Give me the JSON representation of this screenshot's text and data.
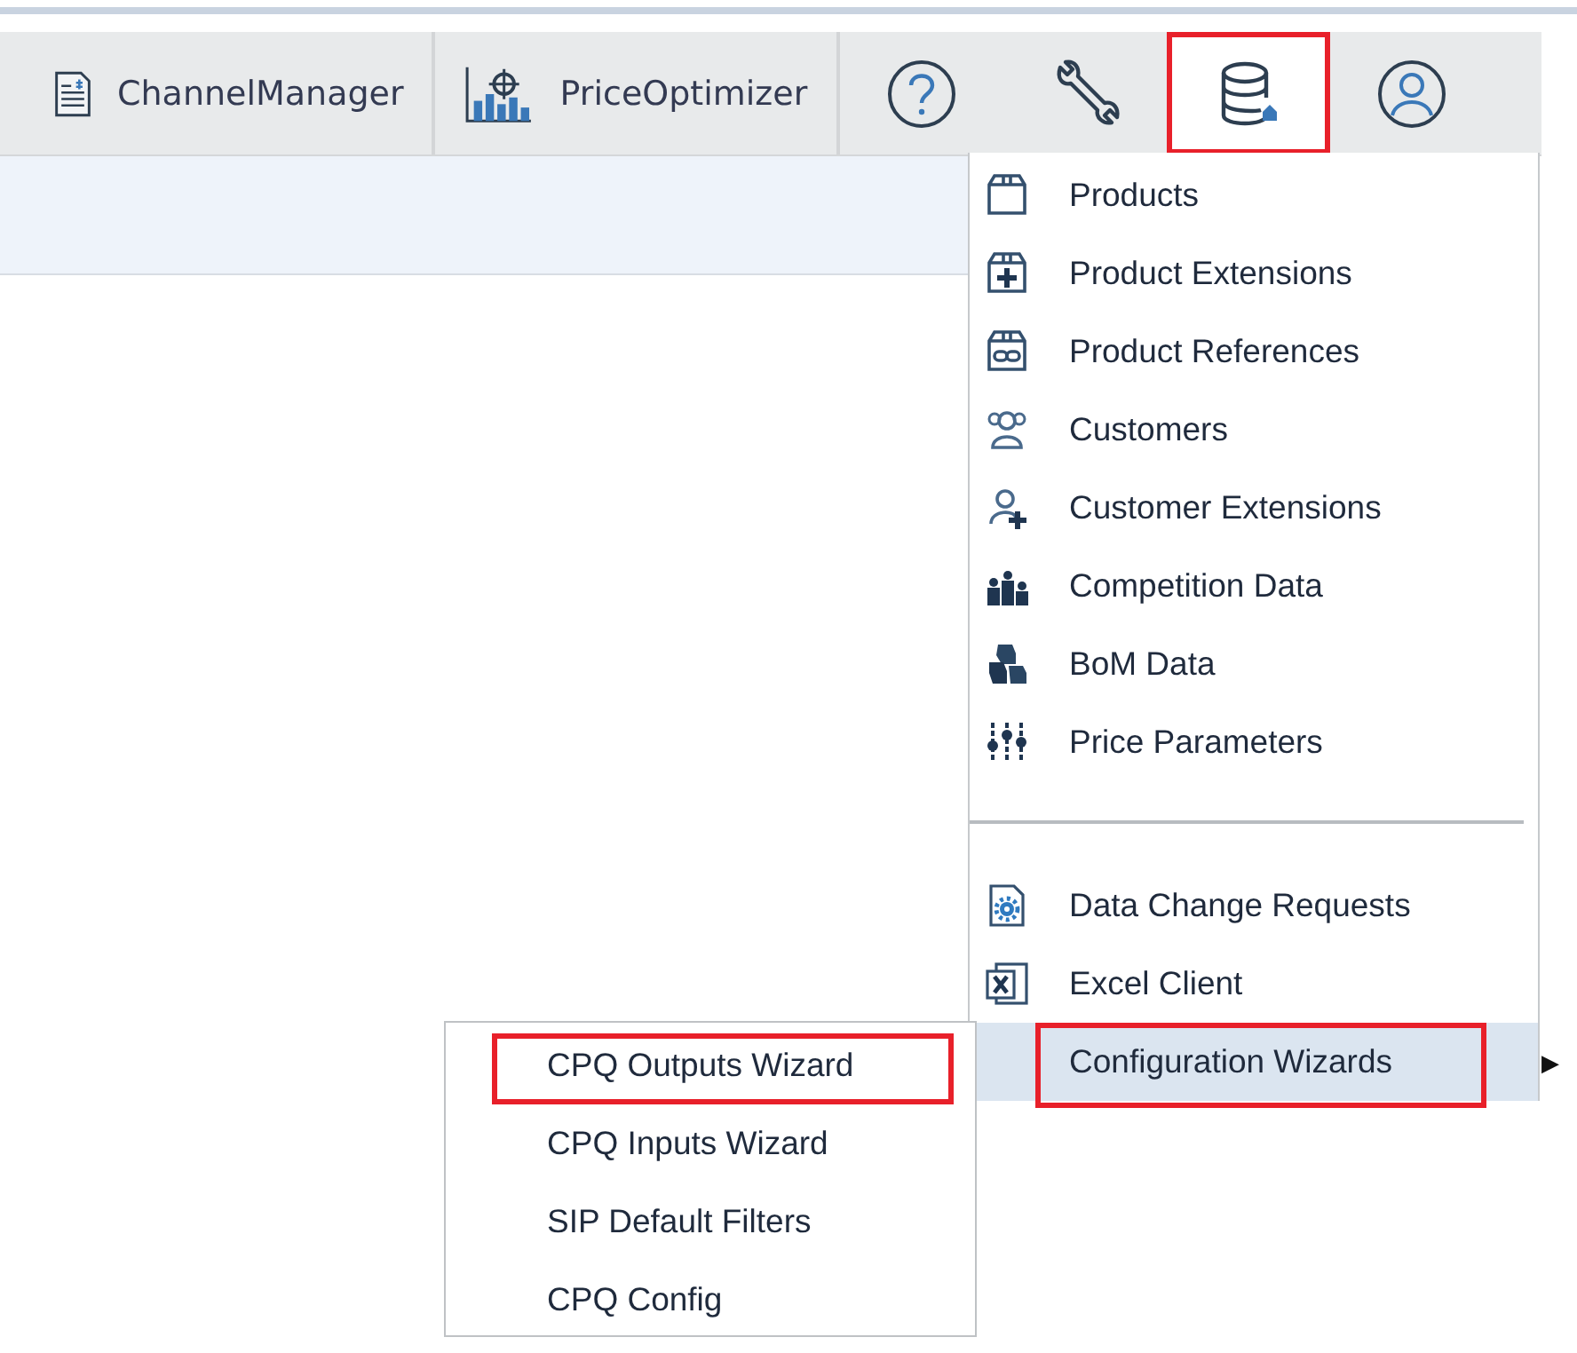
{
  "toolbar": {
    "apps": [
      {
        "label": "ChannelManager",
        "kind": "document"
      },
      {
        "label": "PriceOptimizer",
        "kind": "chart"
      }
    ],
    "buttons": [
      {
        "kind": "help",
        "selected": false,
        "highlighted": false
      },
      {
        "kind": "wrench",
        "selected": false,
        "highlighted": false
      },
      {
        "kind": "database",
        "selected": true,
        "highlighted": true
      },
      {
        "kind": "user",
        "selected": false,
        "highlighted": false
      }
    ]
  },
  "menu": {
    "items": [
      {
        "kind": "item",
        "label": "Products"
      },
      {
        "kind": "item",
        "label": "Product Extensions"
      },
      {
        "kind": "item",
        "label": "Product References"
      },
      {
        "kind": "item",
        "label": "Customers"
      },
      {
        "kind": "item",
        "label": "Customer Extensions"
      },
      {
        "kind": "item",
        "label": "Competition Data"
      },
      {
        "kind": "item",
        "label": "BoM Data"
      },
      {
        "kind": "item",
        "label": "Price Parameters"
      },
      {
        "kind": "separator"
      },
      {
        "kind": "item",
        "label": "Data Change Requests"
      },
      {
        "kind": "item",
        "label": "Excel Client"
      },
      {
        "kind": "submenu",
        "label": "Configuration Wizards",
        "hovered": true,
        "highlighted": true,
        "arrow": "▶"
      }
    ],
    "submenu": [
      {
        "label": "CPQ Outputs Wizard",
        "highlighted": true
      },
      {
        "label": "CPQ Inputs Wizard",
        "highlighted": false
      },
      {
        "label": "SIP Default Filters",
        "highlighted": false
      },
      {
        "label": "CPQ Config",
        "highlighted": false
      }
    ]
  }
}
